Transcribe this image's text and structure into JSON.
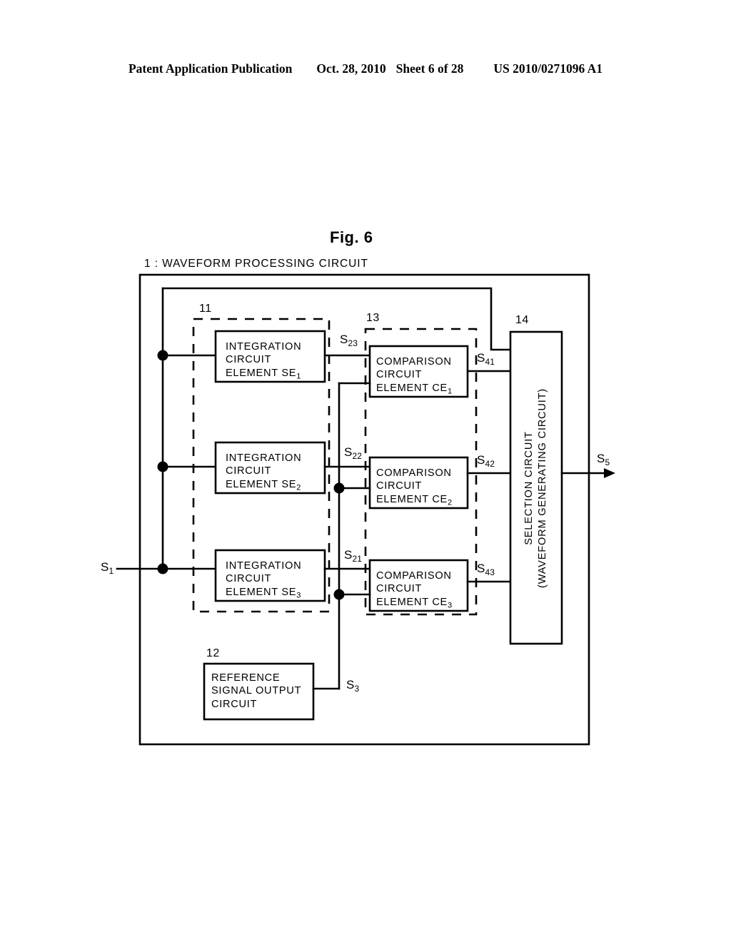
{
  "header": {
    "publication": "Patent Application Publication",
    "date": "Oct. 28, 2010",
    "sheet": "Sheet 6 of 28",
    "number": "US 2010/0271096 A1"
  },
  "figure": {
    "title": "Fig. 6",
    "outer_label": "1 : WAVEFORM PROCESSING CIRCUIT"
  },
  "refs": {
    "integration_group": "11",
    "reference_block": "12",
    "comparison_group": "13",
    "selection_block": "14"
  },
  "blocks": {
    "integration": [
      {
        "line1": "INTEGRATION",
        "line2": "CIRCUIT",
        "line3": "ELEMENT SE",
        "sub": "1"
      },
      {
        "line1": "INTEGRATION",
        "line2": "CIRCUIT",
        "line3": "ELEMENT SE",
        "sub": "2"
      },
      {
        "line1": "INTEGRATION",
        "line2": "CIRCUIT",
        "line3": "ELEMENT SE",
        "sub": "3"
      }
    ],
    "comparison": [
      {
        "line1": "COMPARISON",
        "line2": "CIRCUIT",
        "line3": "ELEMENT  CE",
        "sub": "1"
      },
      {
        "line1": "COMPARISON",
        "line2": "CIRCUIT",
        "line3": "ELEMENT  CE",
        "sub": "2"
      },
      {
        "line1": "COMPARISON",
        "line2": "CIRCUIT",
        "line3": "ELEMENT  CE",
        "sub": "3"
      }
    ],
    "reference_signal": {
      "line1": "REFERENCE",
      "line2": "SIGNAL OUTPUT",
      "line3": "CIRCUIT"
    },
    "selection": {
      "line1": "SELECTION CIRCUIT",
      "line2": "(WAVEFORM GENERATING CIRCUIT)"
    }
  },
  "signals": {
    "input": {
      "base": "S",
      "sub": "1"
    },
    "integration_out": [
      {
        "base": "S",
        "sub": "23"
      },
      {
        "base": "S",
        "sub": "22"
      },
      {
        "base": "S",
        "sub": "21"
      }
    ],
    "reference_out": {
      "base": "S",
      "sub": "3"
    },
    "comparison_out": [
      {
        "base": "S",
        "sub": "41"
      },
      {
        "base": "S",
        "sub": "42"
      },
      {
        "base": "S",
        "sub": "43"
      }
    ],
    "output": {
      "base": "S",
      "sub": "5"
    }
  },
  "style": {
    "line_color": "#000000",
    "background": "#ffffff"
  }
}
